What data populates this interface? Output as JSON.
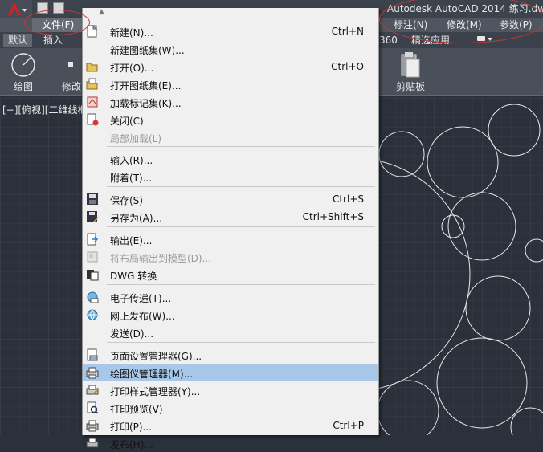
{
  "window": {
    "title": "Autodesk AutoCAD 2014   练习.dw"
  },
  "menubar": {
    "file": "文件(F)",
    "annotate": "标注(N)",
    "modify": "修改(M)",
    "params": "参数(P)"
  },
  "ribbon_tabs": {
    "default": "默认",
    "insert": "插入",
    "a360": "360",
    "featured": "精选应用"
  },
  "ribbon": {
    "draw": "绘图",
    "modify": "修改",
    "clipboard": "剪贴板"
  },
  "viewport": {
    "label": "[−][俯视][二维线框"
  },
  "file_menu": {
    "items": [
      {
        "label": "新建(N)...",
        "shortcut": "Ctrl+N",
        "icon": "new-file-icon",
        "disabled": false
      },
      {
        "label": "新建图纸集(W)...",
        "shortcut": "",
        "icon": "",
        "disabled": false
      },
      {
        "label": "打开(O)...",
        "shortcut": "Ctrl+O",
        "icon": "open-folder-icon",
        "disabled": false
      },
      {
        "label": "打开图纸集(E)...",
        "shortcut": "",
        "icon": "open-sheetset-icon",
        "disabled": false
      },
      {
        "label": "加载标记集(K)...",
        "shortcut": "",
        "icon": "markup-set-icon",
        "disabled": false
      },
      {
        "label": "关闭(C)",
        "shortcut": "",
        "icon": "close-file-icon",
        "disabled": false
      },
      {
        "label": "局部加载(L)",
        "shortcut": "",
        "icon": "",
        "disabled": true
      },
      {
        "label": "输入(R)...",
        "shortcut": "",
        "icon": "",
        "disabled": false
      },
      {
        "label": "附着(T)...",
        "shortcut": "",
        "icon": "",
        "disabled": false
      },
      {
        "label": "保存(S)",
        "shortcut": "Ctrl+S",
        "icon": "save-icon",
        "disabled": false
      },
      {
        "label": "另存为(A)...",
        "shortcut": "Ctrl+Shift+S",
        "icon": "save-as-icon",
        "disabled": false
      },
      {
        "label": "输出(E)...",
        "shortcut": "",
        "icon": "export-icon",
        "disabled": false
      },
      {
        "label": "将布局输出到模型(D)...",
        "shortcut": "",
        "icon": "export-layout-icon",
        "disabled": true
      },
      {
        "label": "DWG 转换",
        "shortcut": "",
        "icon": "dwg-convert-icon",
        "disabled": false
      },
      {
        "label": "电子传递(T)...",
        "shortcut": "",
        "icon": "etransmit-icon",
        "disabled": false
      },
      {
        "label": "网上发布(W)...",
        "shortcut": "",
        "icon": "publish-web-icon",
        "disabled": false
      },
      {
        "label": "发送(D)...",
        "shortcut": "",
        "icon": "",
        "disabled": false
      },
      {
        "label": "页面设置管理器(G)...",
        "shortcut": "",
        "icon": "page-setup-icon",
        "disabled": false
      },
      {
        "label": "绘图仪管理器(M)...",
        "shortcut": "",
        "icon": "plotter-manager-icon",
        "disabled": false
      },
      {
        "label": "打印样式管理器(Y)...",
        "shortcut": "",
        "icon": "plot-style-icon",
        "disabled": false
      },
      {
        "label": "打印预览(V)",
        "shortcut": "",
        "icon": "plot-preview-icon",
        "disabled": false
      },
      {
        "label": "打印(P)...",
        "shortcut": "Ctrl+P",
        "icon": "print-icon",
        "disabled": false
      },
      {
        "label": "发布(H)...",
        "shortcut": "",
        "icon": "publish-icon",
        "disabled": false
      }
    ],
    "highlighted_index": 18
  },
  "colors": {
    "canvas": "#2b313b",
    "menu_bg": "#f0f0f0",
    "highlight": "#a8c8ea",
    "annotation": "#c23838"
  }
}
